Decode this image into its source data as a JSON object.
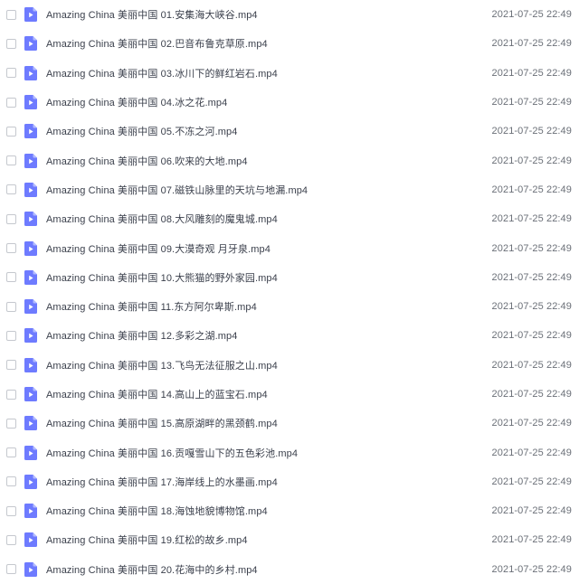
{
  "file_list": {
    "items": [
      {
        "name": "Amazing China 美丽中国 01.安集海大峡谷.mp4",
        "modified": "2021-07-25 22:49",
        "icon": "video-file-icon"
      },
      {
        "name": "Amazing China 美丽中国 02.巴音布鲁克草原.mp4",
        "modified": "2021-07-25 22:49",
        "icon": "video-file-icon"
      },
      {
        "name": "Amazing China 美丽中国 03.冰川下的鲜红岩石.mp4",
        "modified": "2021-07-25 22:49",
        "icon": "video-file-icon"
      },
      {
        "name": "Amazing China 美丽中国 04.冰之花.mp4",
        "modified": "2021-07-25 22:49",
        "icon": "video-file-icon"
      },
      {
        "name": "Amazing China 美丽中国 05.不冻之河.mp4",
        "modified": "2021-07-25 22:49",
        "icon": "video-file-icon"
      },
      {
        "name": "Amazing China 美丽中国 06.吹来的大地.mp4",
        "modified": "2021-07-25 22:49",
        "icon": "video-file-icon"
      },
      {
        "name": "Amazing China 美丽中国 07.磁铁山脉里的天坑与地漏.mp4",
        "modified": "2021-07-25 22:49",
        "icon": "video-file-icon"
      },
      {
        "name": "Amazing China 美丽中国 08.大风雕刻的魔鬼城.mp4",
        "modified": "2021-07-25 22:49",
        "icon": "video-file-icon"
      },
      {
        "name": "Amazing China 美丽中国 09.大漠奇观 月牙泉.mp4",
        "modified": "2021-07-25 22:49",
        "icon": "video-file-icon"
      },
      {
        "name": "Amazing China 美丽中国 10.大熊猫的野外家园.mp4",
        "modified": "2021-07-25 22:49",
        "icon": "video-file-icon"
      },
      {
        "name": "Amazing China 美丽中国 11.东方阿尔卑斯.mp4",
        "modified": "2021-07-25 22:49",
        "icon": "video-file-icon"
      },
      {
        "name": "Amazing China 美丽中国 12.多彩之湖.mp4",
        "modified": "2021-07-25 22:49",
        "icon": "video-file-icon"
      },
      {
        "name": "Amazing China 美丽中国 13.飞鸟无法征服之山.mp4",
        "modified": "2021-07-25 22:49",
        "icon": "video-file-icon"
      },
      {
        "name": "Amazing China 美丽中国 14.高山上的蓝宝石.mp4",
        "modified": "2021-07-25 22:49",
        "icon": "video-file-icon"
      },
      {
        "name": "Amazing China 美丽中国 15.高原湖畔的黑颈鹤.mp4",
        "modified": "2021-07-25 22:49",
        "icon": "video-file-icon"
      },
      {
        "name": "Amazing China 美丽中国 16.贡嘎雪山下的五色彩池.mp4",
        "modified": "2021-07-25 22:49",
        "icon": "video-file-icon"
      },
      {
        "name": "Amazing China 美丽中国 17.海岸线上的水墨画.mp4",
        "modified": "2021-07-25 22:49",
        "icon": "video-file-icon"
      },
      {
        "name": "Amazing China 美丽中国 18.海蚀地貌博物馆.mp4",
        "modified": "2021-07-25 22:49",
        "icon": "video-file-icon"
      },
      {
        "name": "Amazing China 美丽中国 19.红松的故乡.mp4",
        "modified": "2021-07-25 22:49",
        "icon": "video-file-icon"
      },
      {
        "name": "Amazing China 美丽中国 20.花海中的乡村.mp4",
        "modified": "2021-07-25 22:49",
        "icon": "video-file-icon"
      }
    ],
    "colors": {
      "icon_primary": "#6e7bff",
      "icon_fold": "#b4bcff",
      "name_text": "#3a3f4b",
      "date_text": "#6b7078",
      "checkbox_border": "#c5c8ce"
    }
  }
}
